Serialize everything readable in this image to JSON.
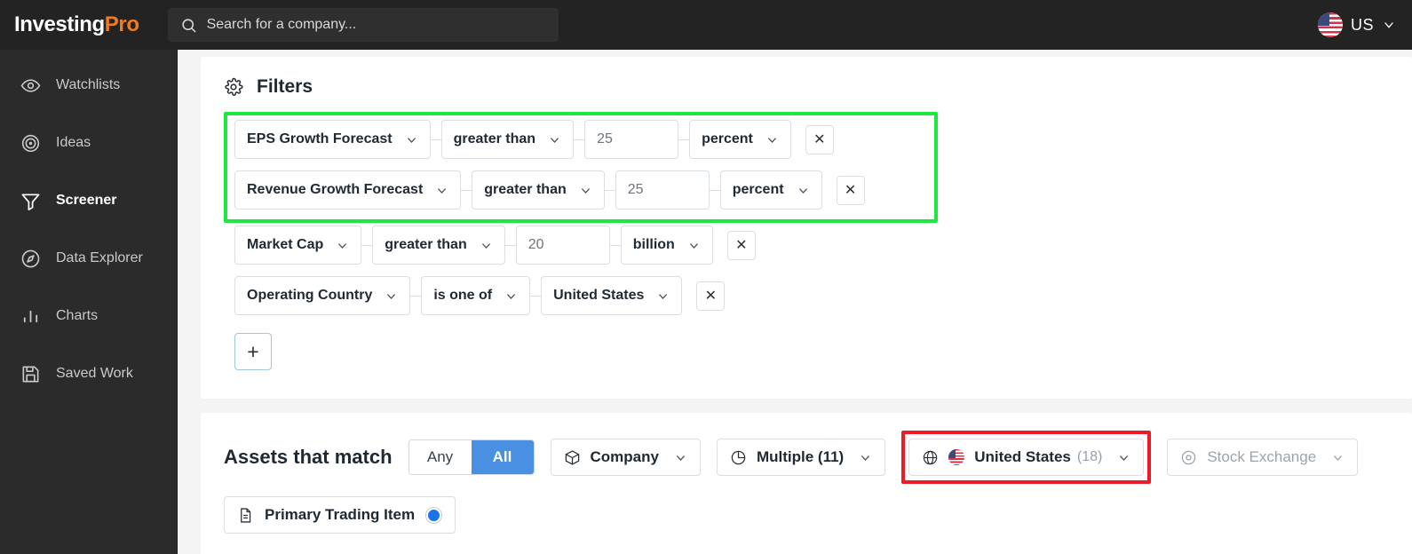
{
  "header": {
    "brand_part1": "Investing",
    "brand_part2": "Pro",
    "search_placeholder": "Search for a company...",
    "search_icon": "search-icon",
    "locale_label": "US",
    "locale_flag": "us-flag-icon",
    "locale_chevron": "chevron-down-icon"
  },
  "sidebar": {
    "items": [
      {
        "label": "Watchlists",
        "icon": "eye-icon",
        "active": false
      },
      {
        "label": "Ideas",
        "icon": "target-icon",
        "active": false
      },
      {
        "label": "Screener",
        "icon": "funnel-icon",
        "active": true
      },
      {
        "label": "Data Explorer",
        "icon": "compass-icon",
        "active": false
      },
      {
        "label": "Charts",
        "icon": "bar-chart-icon",
        "active": false
      },
      {
        "label": "Saved Work",
        "icon": "save-icon",
        "active": false
      }
    ]
  },
  "filters_panel": {
    "title": "Filters",
    "title_icon": "gear-icon",
    "add_filter_label": "+",
    "remove_label": "✕",
    "highlight_color": "#1ce840",
    "rows": [
      {
        "metric": "EPS Growth Forecast",
        "operator": "greater than",
        "value": "25",
        "unit": "percent",
        "highlighted": true
      },
      {
        "metric": "Revenue Growth Forecast",
        "operator": "greater than",
        "value": "25",
        "unit": "percent",
        "highlighted": true
      },
      {
        "metric": "Market Cap",
        "operator": "greater than",
        "value": "20",
        "unit": "billion",
        "highlighted": false
      },
      {
        "metric": "Operating Country",
        "operator": "is one of",
        "value": "United States",
        "unit": null,
        "highlighted": false
      }
    ]
  },
  "assets_panel": {
    "title": "Assets that match",
    "match_options": [
      {
        "label": "Any",
        "selected": false
      },
      {
        "label": "All",
        "selected": true
      }
    ],
    "match_accent": "#4a90e2",
    "pills": [
      {
        "label": "Company",
        "count": null,
        "icon": "cube-icon",
        "muted": false,
        "highlighted": false
      },
      {
        "label": "Multiple (11)",
        "count": null,
        "icon": "pie-chart-icon",
        "muted": false,
        "highlighted": false
      },
      {
        "label": "United States",
        "count": "(18)",
        "icon": "globe-icon",
        "flag": "us-flag-icon",
        "muted": false,
        "highlighted": true
      },
      {
        "label": "Stock Exchange",
        "count": null,
        "icon": "location-pin-icon",
        "muted": true,
        "highlighted": false
      }
    ],
    "highlight_color": "#ed1c24",
    "primary_trading_item": {
      "label": "Primary Trading Item",
      "icon": "document-icon",
      "selected": true,
      "radio_color": "#1a73e8"
    }
  }
}
